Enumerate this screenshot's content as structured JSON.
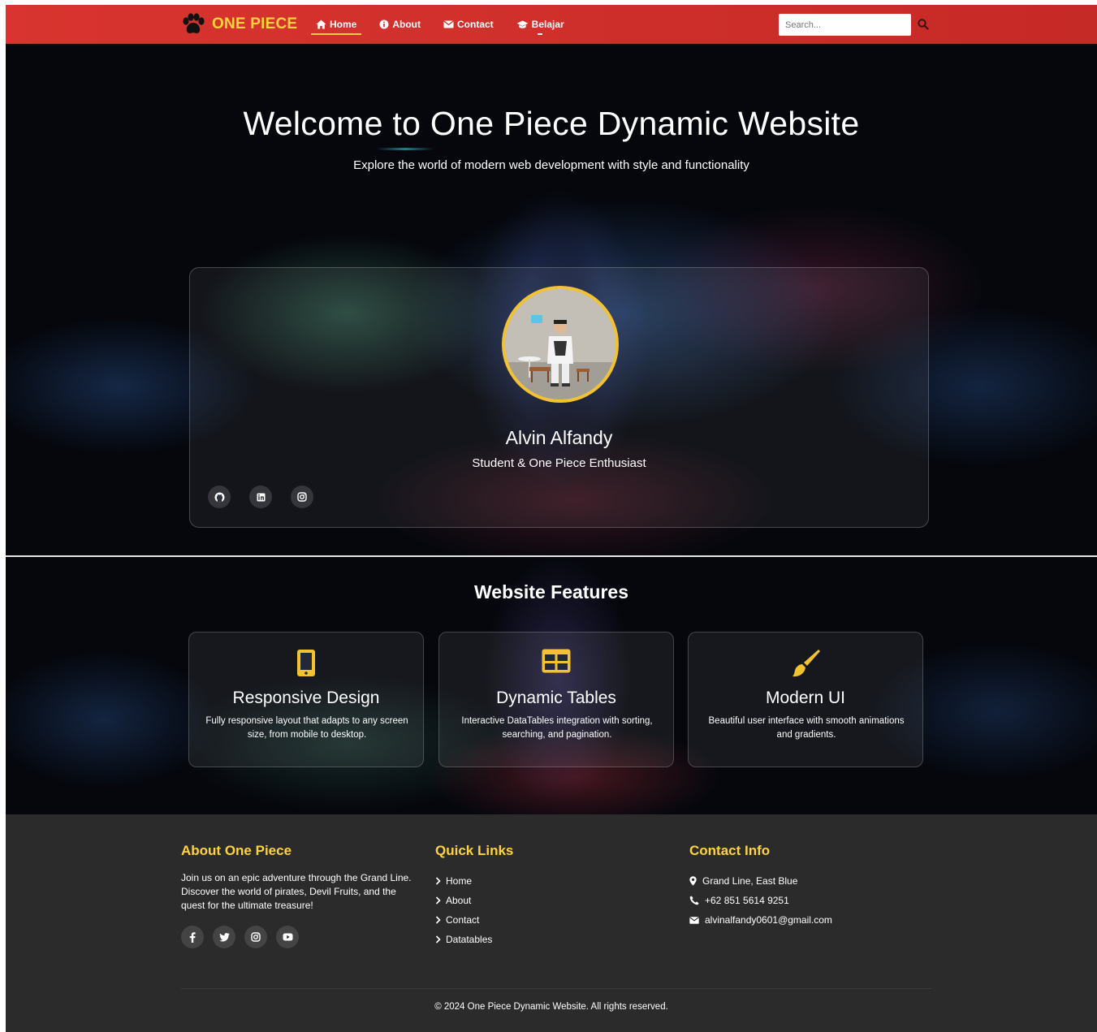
{
  "nav": {
    "brand": "ONE PIECE",
    "links": [
      {
        "label": "Home",
        "icon": "home-icon"
      },
      {
        "label": "About",
        "icon": "info-icon"
      },
      {
        "label": "Contact",
        "icon": "envelope-icon"
      },
      {
        "label": "Belajar",
        "icon": "graduation-cap-icon"
      }
    ],
    "search_placeholder": "Search..."
  },
  "hero": {
    "title": "Welcome to One Piece Dynamic Website",
    "subtitle": "Explore the world of modern web development with style and functionality"
  },
  "profile": {
    "name": "Alvin Alfandy",
    "role": "Student & One Piece Enthusiast",
    "socials": [
      "github-icon",
      "linkedin-icon",
      "instagram-icon"
    ]
  },
  "features": {
    "title": "Website Features",
    "cards": [
      {
        "icon": "mobile-icon",
        "title": "Responsive Design",
        "desc": "Fully responsive layout that adapts to any screen size, from mobile to desktop."
      },
      {
        "icon": "table-icon",
        "title": "Dynamic Tables",
        "desc": "Interactive DataTables integration with sorting, searching, and pagination."
      },
      {
        "icon": "paint-brush-icon",
        "title": "Modern UI",
        "desc": "Beautiful user interface with smooth animations and gradients."
      }
    ]
  },
  "footer": {
    "about_title": "About One Piece",
    "about_text": "Join us on an epic adventure through the Grand Line. Discover the world of pirates, Devil Fruits, and the quest for the ultimate treasure!",
    "socials": [
      "facebook-icon",
      "twitter-icon",
      "instagram-icon",
      "youtube-icon"
    ],
    "links_title": "Quick Links",
    "links": [
      "Home",
      "About",
      "Contact",
      "Datatables"
    ],
    "contact_title": "Contact Info",
    "contact": {
      "address": "Grand Line, East Blue",
      "phone": "+62 851 5614 9251",
      "email": "alvinalfandy0601@gmail.com"
    },
    "copyright": "© 2024 One Piece Dynamic Website. All rights reserved."
  },
  "colors": {
    "nav_red": "#d9342f",
    "accent_yellow": "#ffd43b",
    "footer_bg": "#2b2b2b",
    "hero_bg": "#05070d"
  }
}
